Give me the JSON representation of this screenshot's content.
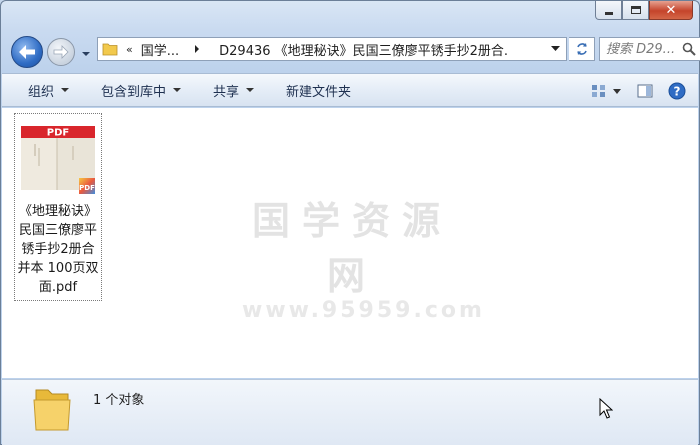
{
  "window": {
    "caption_buttons": [
      "minimize",
      "maximize",
      "close"
    ]
  },
  "nav": {
    "address": {
      "crumb_chevron": "«",
      "crumb_root": "国学...",
      "path": "D29436 《地理秘诀》民国三僚廖平锈手抄2册合..."
    },
    "search": {
      "placeholder": "搜索 D29..."
    }
  },
  "toolbar": {
    "items": [
      {
        "label": "组织",
        "has_dropdown": true
      },
      {
        "label": "包含到库中",
        "has_dropdown": true
      },
      {
        "label": "共享",
        "has_dropdown": true
      },
      {
        "label": "新建文件夹",
        "has_dropdown": false
      }
    ]
  },
  "files": [
    {
      "name": "《地理秘诀》民国三僚廖平锈手抄2册合并本 100页双面.pdf",
      "thumb_label": "PDF",
      "badge": "PDF",
      "type": "pdf"
    }
  ],
  "watermark": {
    "title": "国学资源网",
    "subtitle": "www.95959.com"
  },
  "status": {
    "count_text": "1 个对象"
  },
  "colors": {
    "pdf_red": "#d9262c",
    "folder_yellow": "#f2c94c",
    "accent_blue": "#2f6cc4"
  }
}
